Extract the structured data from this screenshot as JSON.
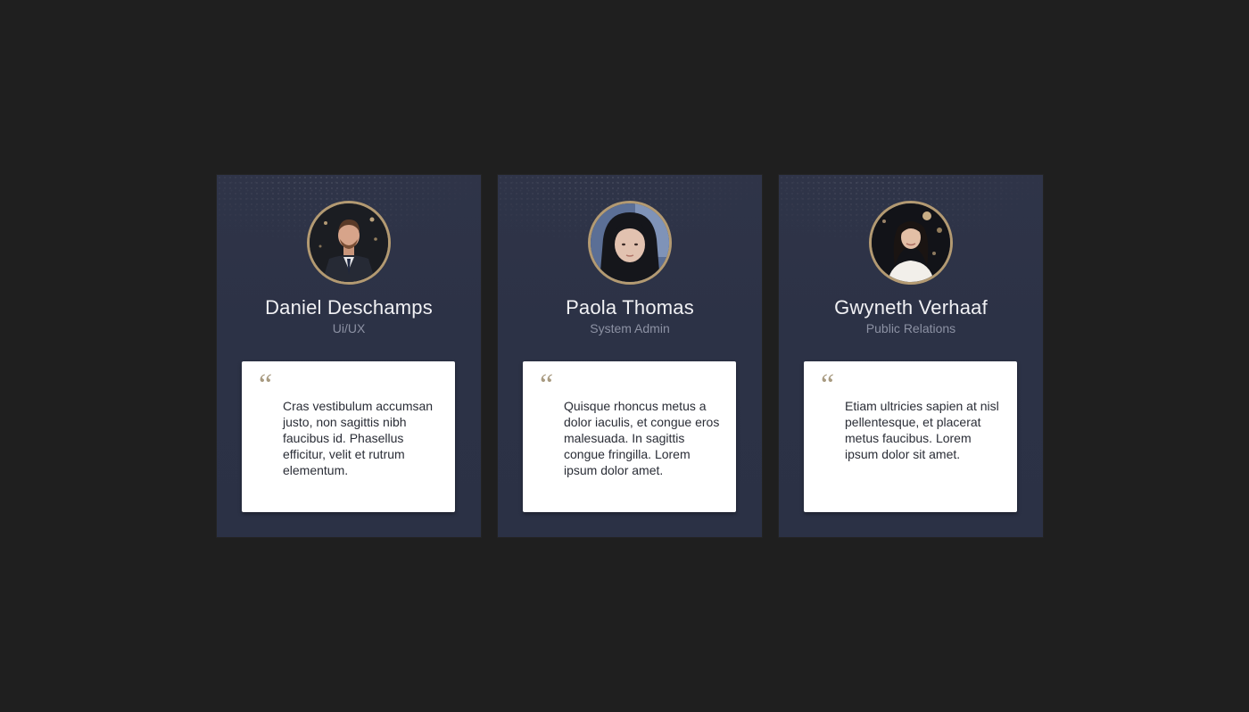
{
  "testimonials": [
    {
      "name": "Daniel Deschamps",
      "role": "Ui/UX",
      "quote_mark": "“",
      "quote": "Cras vestibulum accumsan justo, non sagittis nibh faucibus id. Phasellus efficitur, velit et rutrum elementum.",
      "avatar_icon": "man-portrait"
    },
    {
      "name": "Paola Thomas",
      "role": "System Admin",
      "quote_mark": "“",
      "quote": "Quisque rhoncus metus a dolor iaculis, et congue eros malesuada. In sagittis congue fringilla. Lorem ipsum dolor amet.",
      "avatar_icon": "woman-portrait"
    },
    {
      "name": "Gwyneth Verhaaf",
      "role": "Public Relations",
      "quote_mark": "“",
      "quote": "Etiam ultricies sapien at nisl pellentesque, et placerat metus faucibus. Lorem ipsum dolor sit amet.",
      "avatar_icon": "woman-portrait"
    }
  ],
  "colors": {
    "background": "#1f1f1f",
    "card": "#2d3347",
    "avatar_ring": "#b39a72",
    "name": "#f1f1f4",
    "role": "#8c91a3",
    "quote_mark": "#a89a80",
    "quote_text": "#2a2d36"
  }
}
